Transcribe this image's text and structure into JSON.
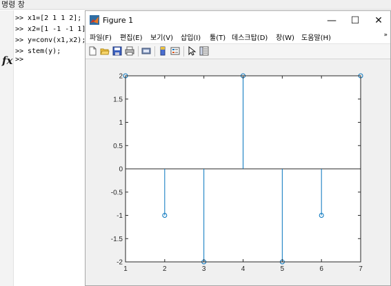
{
  "command_window": {
    "title": "명령 창",
    "lines": [
      ">> x1=[2 1 1 2];",
      ">> x2=[1 -1 -1 1];",
      ">> y=conv(x1,x2);",
      ">> stem(y);"
    ],
    "fx_symbol": "fx",
    "prompt": ">>"
  },
  "figure": {
    "title": "Figure 1",
    "window_buttons": {
      "minimize": "—",
      "maximize": "☐",
      "close": "✕"
    },
    "menu": [
      "파일(F)",
      "편집(E)",
      "보기(V)",
      "삽입(I)",
      "툴(T)",
      "데스크탑(D)",
      "창(W)",
      "도움말(H)"
    ],
    "menu_overflow": "»",
    "toolbar_icons": [
      "new-figure-icon",
      "open-file-icon",
      "save-icon",
      "print-icon",
      "link-plot-icon",
      "insert-colorbar-icon",
      "insert-legend-icon",
      "edit-plot-pointer-icon",
      "property-inspector-icon"
    ]
  },
  "chart_data": {
    "type": "stem",
    "x": [
      1,
      2,
      3,
      4,
      5,
      6,
      7
    ],
    "values": [
      2,
      -1,
      -2,
      2,
      -2,
      -1,
      2
    ],
    "xlim": [
      1,
      7
    ],
    "ylim": [
      -2,
      2
    ],
    "xticks": [
      "1",
      "2",
      "3",
      "4",
      "5",
      "6",
      "7"
    ],
    "yticks": [
      "-2",
      "-1.5",
      "-1",
      "-0.5",
      "0",
      "0.5",
      "1",
      "1.5",
      "2"
    ],
    "grid": false,
    "title": "",
    "xlabel": "",
    "ylabel": "",
    "colors": {
      "stem": "#0072bd",
      "axes": "#262626",
      "background": "#ffffff",
      "figure_bg": "#f0f0f0"
    }
  }
}
